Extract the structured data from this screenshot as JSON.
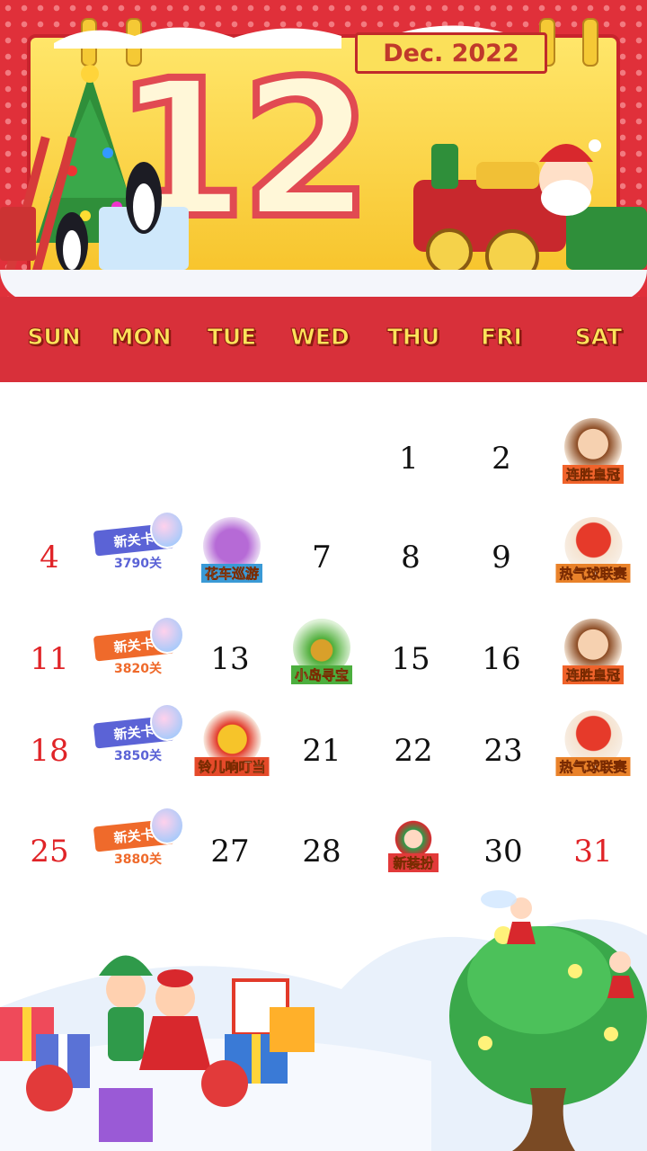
{
  "banner": {
    "month_number": "12",
    "month_label": "Dec. 2022",
    "weekdays": [
      "SUN",
      "MON",
      "TUE",
      "WED",
      "THU",
      "FRI",
      "SAT"
    ]
  },
  "calendar": {
    "days": {
      "d1": "1",
      "d2": "2",
      "d4": "4",
      "d7": "7",
      "d8": "8",
      "d9": "9",
      "d11": "11",
      "d13": "13",
      "d15": "15",
      "d16": "16",
      "d18": "18",
      "d21": "21",
      "d22": "22",
      "d23": "23",
      "d25": "25",
      "d27": "27",
      "d28": "28",
      "d30": "30",
      "d31": "31"
    },
    "events": {
      "crown": "连胜皇冠",
      "parade": "花车巡游",
      "balloon": "热气球联赛",
      "island": "小岛寻宝",
      "bell": "铃儿响叮当",
      "costume": "新装扮"
    },
    "new_level": {
      "label": "新关卡",
      "w1": "3790关",
      "w2": "3820关",
      "w3": "3850关",
      "w4": "3880关"
    }
  },
  "colors": {
    "weekend": "#e02428",
    "weekday": "#111111",
    "ribbon_blue": "#5b63d6",
    "ribbon_orange": "#ef6a2b"
  },
  "icons": [
    "crown-princess-icon",
    "parade-float-icon",
    "hot-air-balloon-icon",
    "palm-island-icon",
    "jingle-bell-icon",
    "elves-costume-icon",
    "candy-jar-icon"
  ]
}
